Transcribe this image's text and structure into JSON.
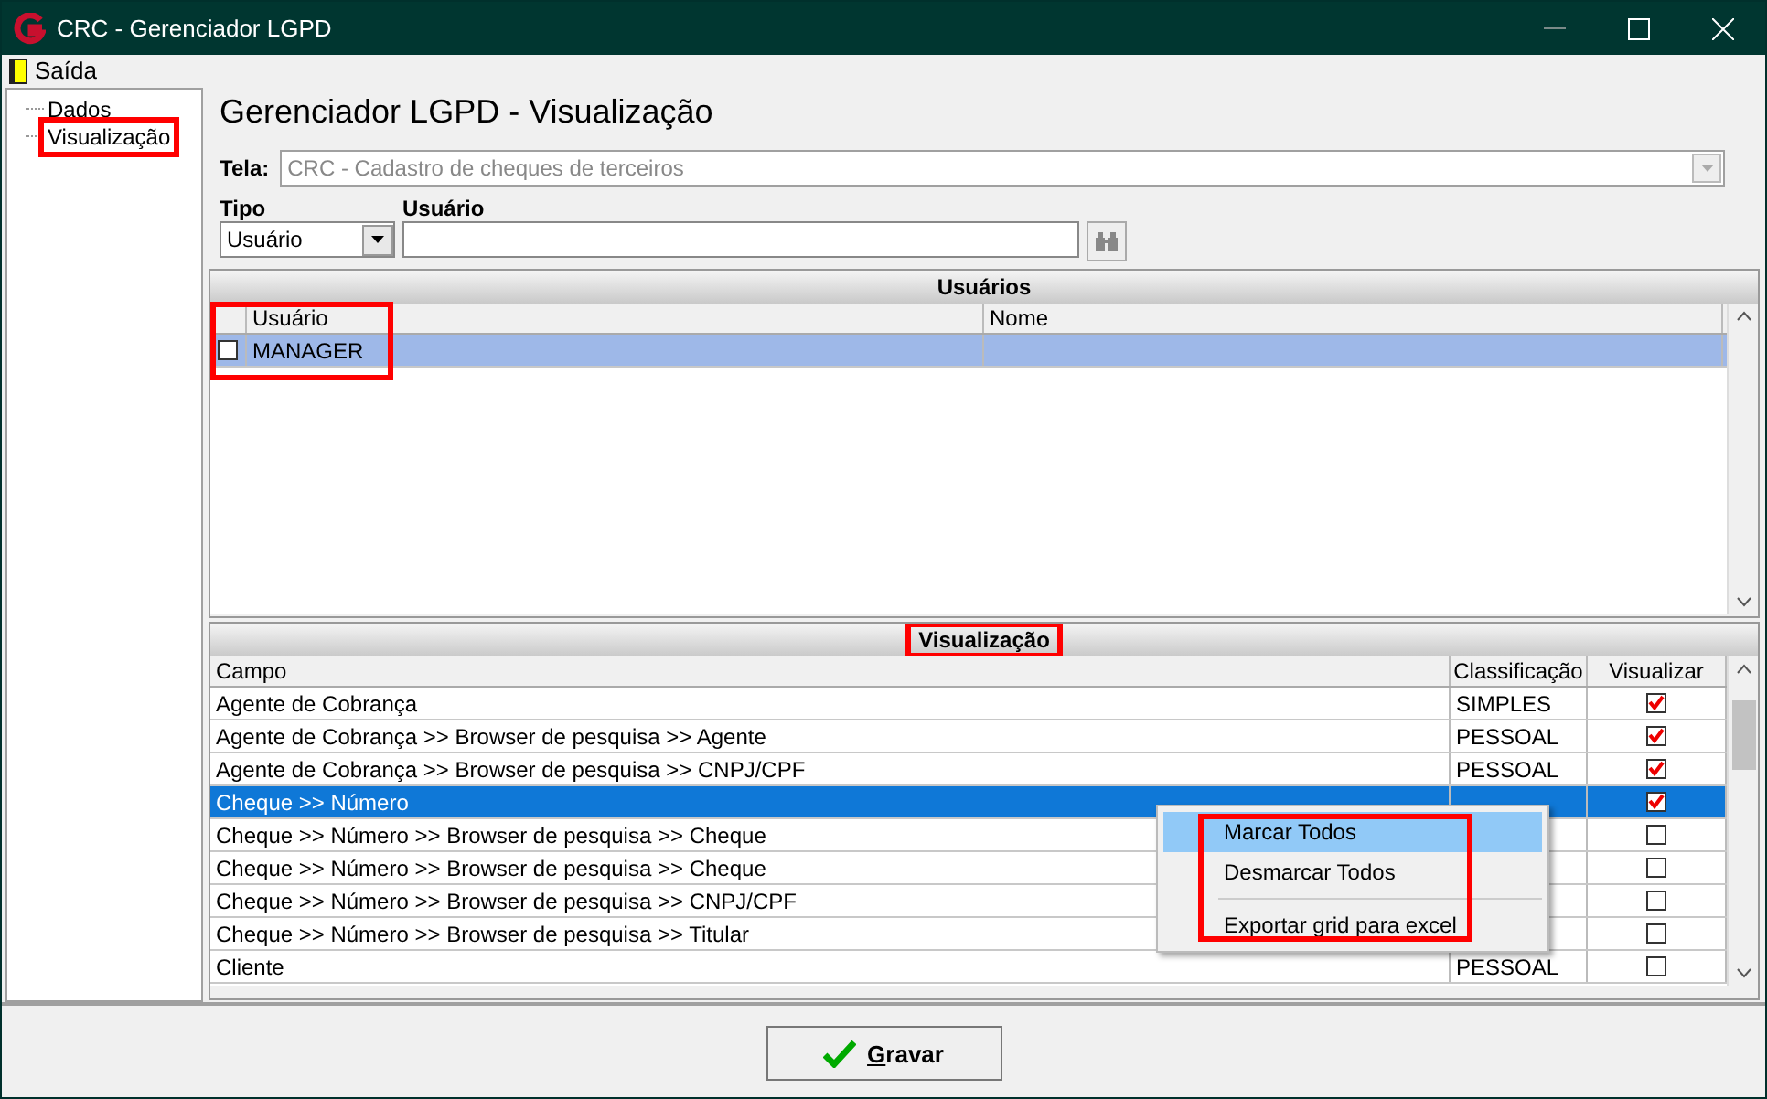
{
  "window": {
    "title": "CRC - Gerenciador LGPD"
  },
  "menu": [
    {
      "label": "Saída"
    }
  ],
  "tree": {
    "items": [
      {
        "label": "Dados",
        "highlighted": false
      },
      {
        "label": "Visualização",
        "highlighted": true
      }
    ]
  },
  "page_title": "Gerenciador LGPD - Visualização",
  "tela": {
    "label": "Tela:",
    "value": "CRC - Cadastro de cheques de terceiros",
    "disabled": true
  },
  "tipo": {
    "label": "Tipo",
    "value": "Usuário"
  },
  "usuario": {
    "label": "Usuário"
  },
  "users": {
    "title": "Usuários",
    "highlighted": true,
    "columns": [
      "Usuário",
      "Nome"
    ],
    "rows": [
      {
        "usuario": "MANAGER",
        "checked": false,
        "selected": true
      }
    ]
  },
  "visualizacao": {
    "title": "Visualização",
    "title_highlighted": true,
    "columns": [
      "Campo",
      "Classificação",
      "Visualizar"
    ],
    "rows": [
      {
        "campo": "Agente de Cobrança",
        "classificacao": "SIMPLES",
        "visualizar": true,
        "selected": false
      },
      {
        "campo": "Agente de Cobrança >> Browser de pesquisa >> Agente",
        "classificacao": "PESSOAL",
        "visualizar": true,
        "selected": false
      },
      {
        "campo": "Agente de Cobrança >> Browser de pesquisa >> CNPJ/CPF",
        "classificacao": "PESSOAL",
        "visualizar": true,
        "selected": false
      },
      {
        "campo": "Cheque >> Número",
        "visualizar": true,
        "selected": true
      },
      {
        "campo": "Cheque >> Número >> Browser de pesquisa >> Cheque",
        "visualizar": false,
        "selected": false
      },
      {
        "campo": "Cheque >> Número >> Browser de pesquisa >> Cheque",
        "visualizar": false,
        "selected": false
      },
      {
        "campo": "Cheque >> Número >> Browser de pesquisa >> CNPJ/CPF",
        "visualizar": false,
        "selected": false
      },
      {
        "campo": "Cheque >> Número >> Browser de pesquisa >> Titular",
        "visualizar": false,
        "selected": false
      },
      {
        "campo": "Cliente",
        "classificacao": "PESSOAL",
        "visualizar": false,
        "selected": false
      }
    ]
  },
  "context_menu": {
    "highlighted": true,
    "items": [
      {
        "kind": "item",
        "label": "Marcar Todos",
        "hovered": true
      },
      {
        "kind": "item",
        "label": "Desmarcar Todos",
        "hovered": false
      },
      {
        "kind": "separator"
      },
      {
        "kind": "item",
        "label": "Exportar grid para excel",
        "hovered": false
      }
    ]
  },
  "save_button": {
    "label": "Gravar"
  }
}
